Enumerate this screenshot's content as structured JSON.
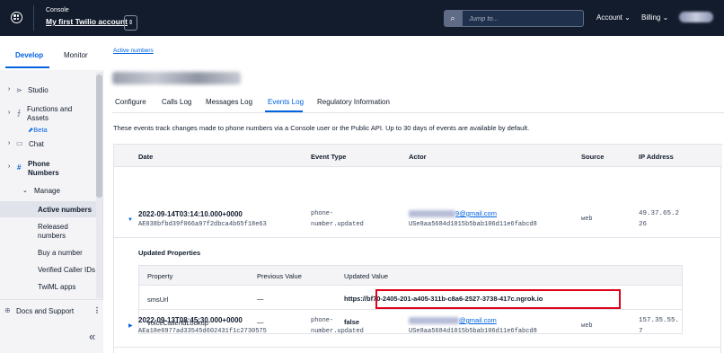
{
  "topbar": {
    "console_label": "Console",
    "account_name": "My first Twilio account",
    "switcher_icon": "⇕",
    "search_icon": "⌕",
    "search_placeholder": "Jump to...",
    "account_menu": "Account ⌄",
    "billing_menu": "Billing ⌄"
  },
  "sidebar": {
    "tabs": [
      "Develop",
      "Monitor"
    ],
    "items": [
      {
        "label": "Studio"
      },
      {
        "label": "Functions and"
      },
      {
        "label": "Assets"
      },
      {
        "label": "Chat"
      },
      {
        "label": "Phone"
      },
      {
        "label": "Numbers"
      },
      {
        "label": "Manage"
      },
      {
        "label": "Active numbers"
      },
      {
        "label": "Released"
      },
      {
        "label": "numbers"
      },
      {
        "label": "Buy a number"
      },
      {
        "label": "Verified Caller IDs"
      },
      {
        "label": "TwiML apps"
      }
    ],
    "beta": "⬈Beta",
    "docs": "Docs and Support",
    "more": "⋮",
    "collapse": "«"
  },
  "main": {
    "breadcrumb": "Active numbers",
    "tabs": [
      "Configure",
      "Calls Log",
      "Messages Log",
      "Events Log",
      "Regulatory Information"
    ],
    "active_tab": "Events Log",
    "description": "These events track changes made to phone numbers via a Console user or the Public API. Up to 30 days of events are available by default.",
    "columns": [
      "Date",
      "Event Type",
      "Actor",
      "Source",
      "IP Address"
    ],
    "rows": [
      {
        "date": "2022-09-14T03:14:10.000+0000",
        "sid": "AE038bfbd39f066a97f2dbca4b65f18e63",
        "event_type_1": "phone-",
        "event_type_2": "number.updated",
        "actor_email": "9@gmail.com",
        "actor_sid": "USe8aa5684d1015b5bab106d11e6fabcd8",
        "source": "web",
        "ip_1": "49.37.65.2",
        "ip_2": "26"
      },
      {
        "date": "2022-09-13T08:45:30.000+0000",
        "sid": "AEa18e6977ad33545d602431f1c2730575",
        "event_type_1": "phone-",
        "event_type_2": "number.updated",
        "actor_email": "@gmail.com",
        "actor_sid": "USe8aa5684d1015b5bab106d11e6fabcd8",
        "source": "web",
        "ip_1": "157.35.55.",
        "ip_2": "7"
      }
    ],
    "updated_properties": {
      "title": "Updated Properties",
      "columns": [
        "Property",
        "Previous Value",
        "Updated Value"
      ],
      "rows": [
        {
          "property": "smsUrl",
          "previous": "—",
          "updated": "https://bf70-2405-201-a405-311b-c8a6-2527-3738-417c.ngrok.io"
        },
        {
          "property": "voiceCallerIdLookup",
          "previous": "—",
          "updated": "false"
        }
      ]
    }
  },
  "colors": {
    "topbar_bg": "#121c2d",
    "accent": "#0263e0",
    "highlight_box": "#e0001a"
  }
}
